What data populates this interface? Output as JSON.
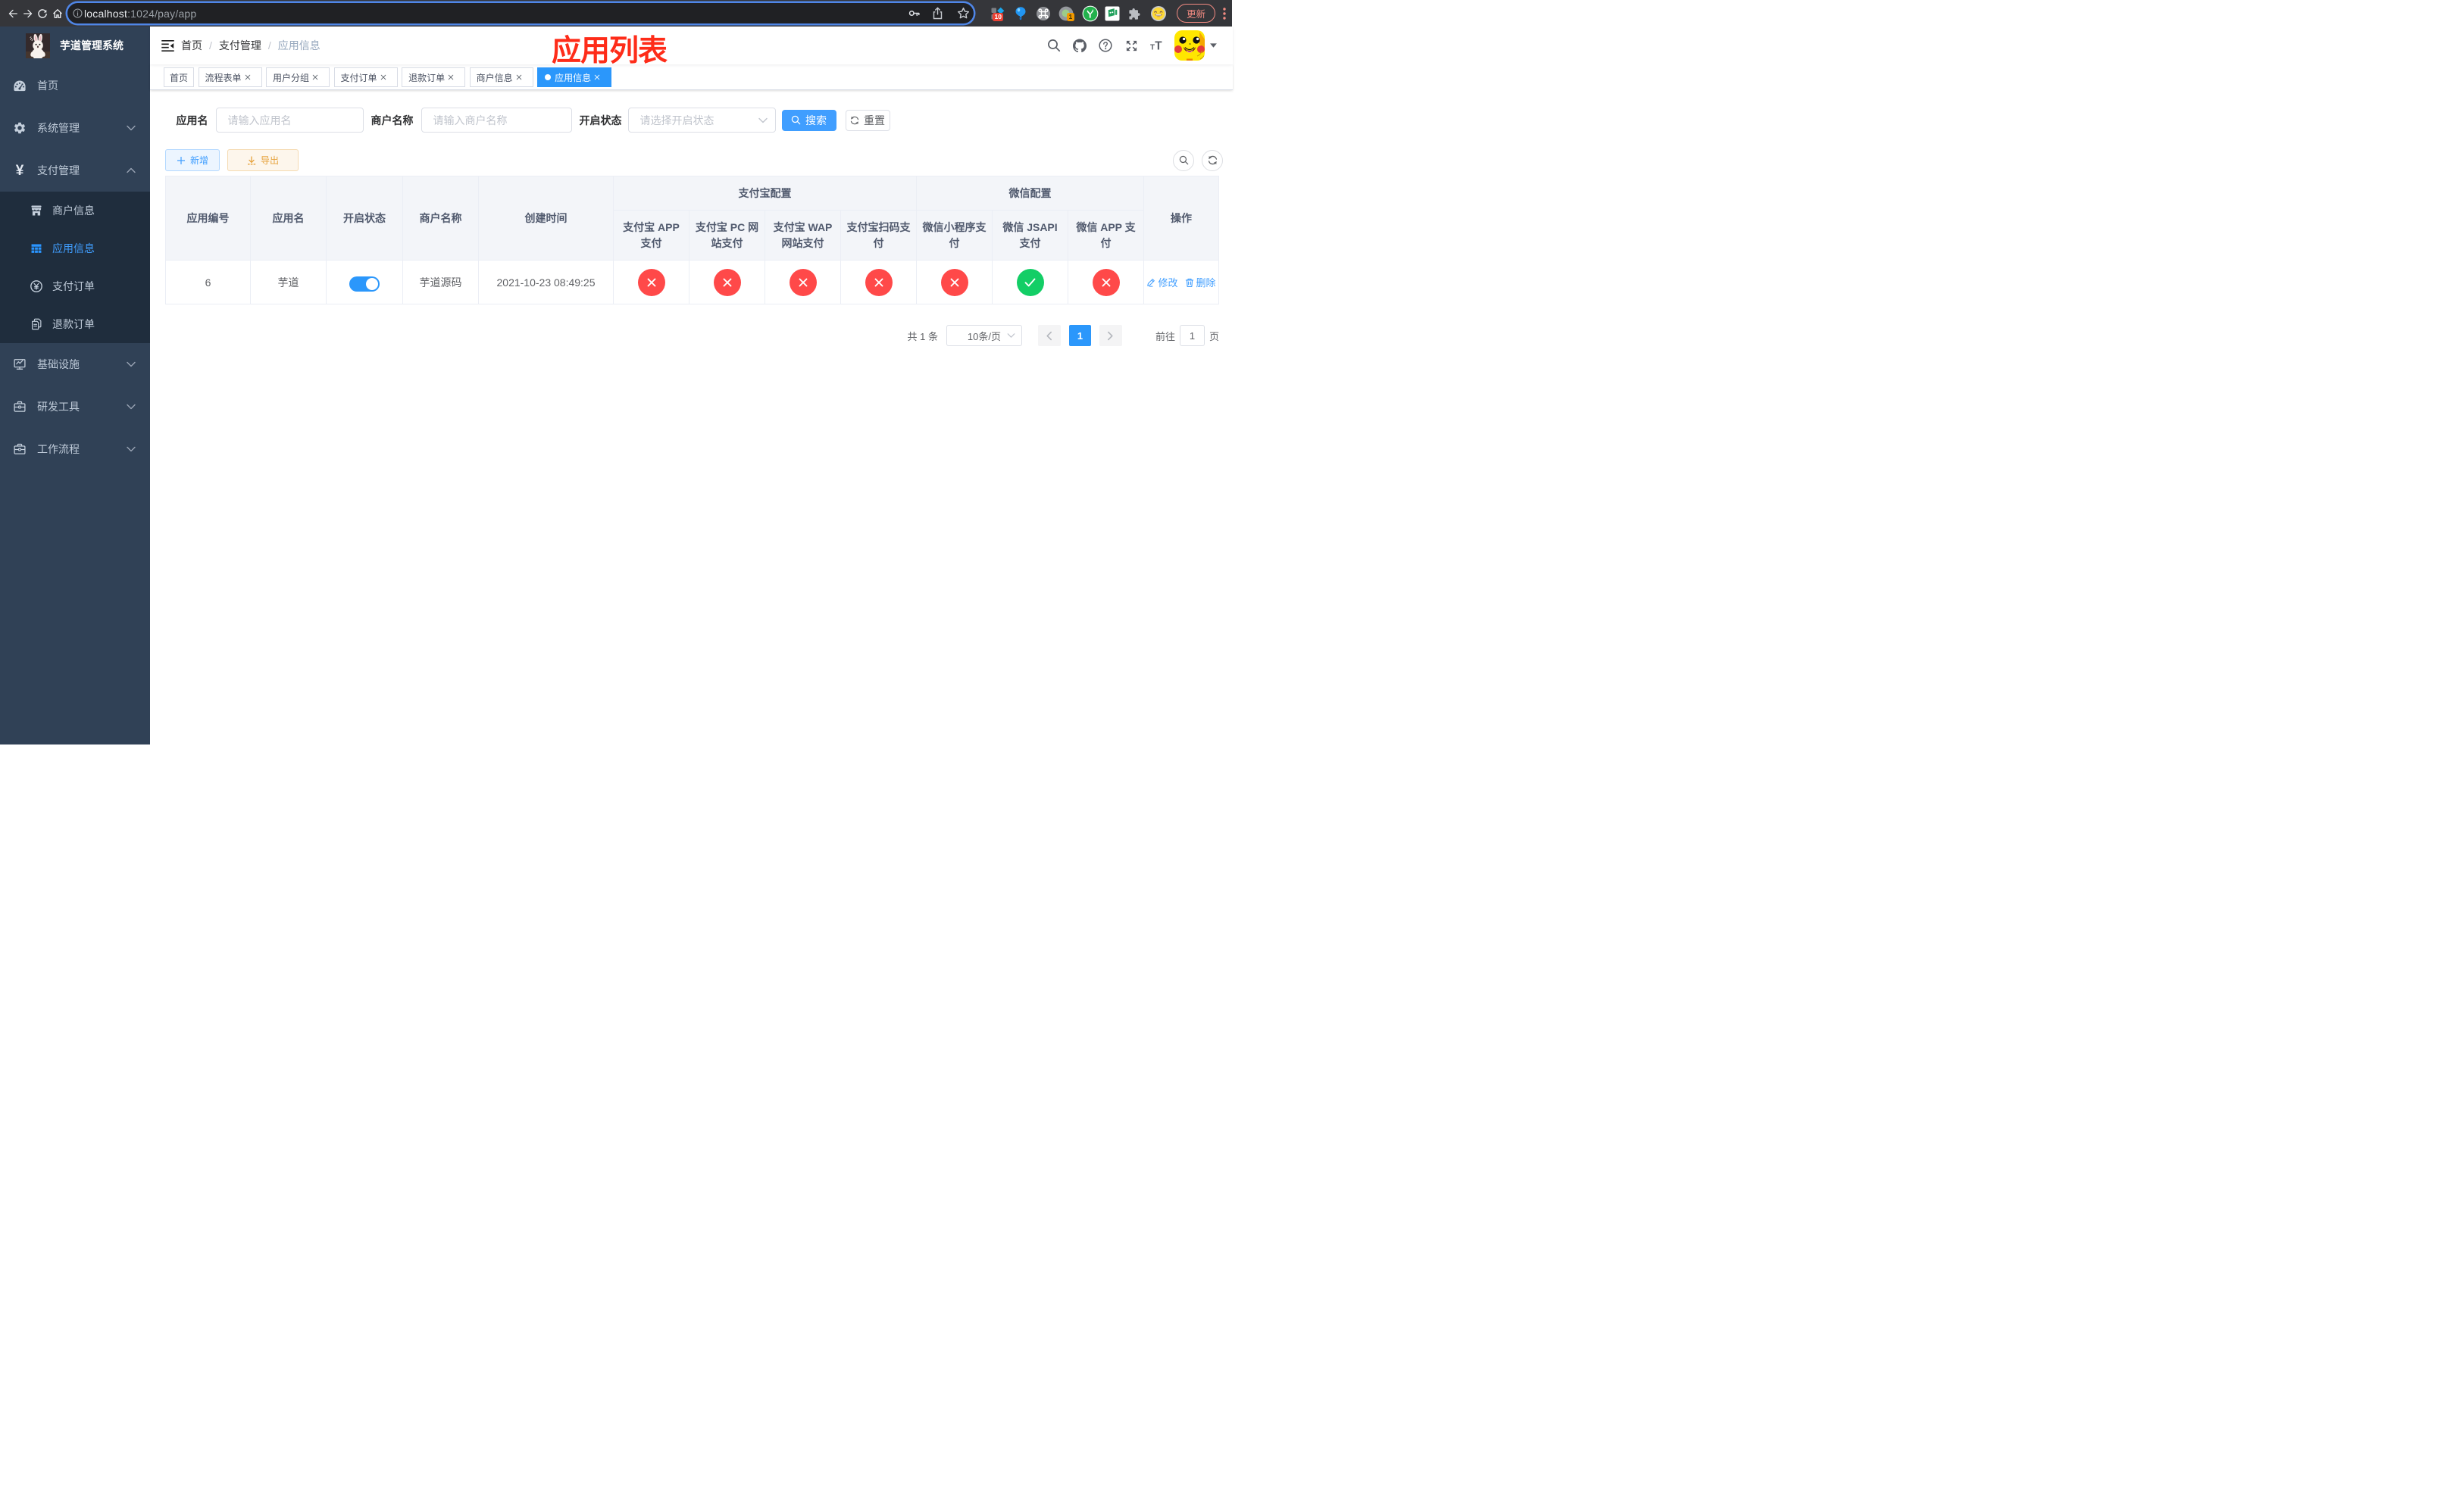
{
  "browser": {
    "url_host": "localhost",
    "url_rest": ":1024/pay/app",
    "update_label": "更新",
    "ext_badge_count_a": "10",
    "ext_badge_count_b": "1"
  },
  "annotation": {
    "text": "应用列表",
    "color": "#fe2c19"
  },
  "sidebar": {
    "logo_title": "芋道管理系统",
    "items": [
      {
        "label": "首页",
        "icon": "dashboard-icon"
      },
      {
        "label": "系统管理",
        "icon": "gear-icon",
        "chevron": "down"
      },
      {
        "label": "支付管理",
        "icon": "yen-icon",
        "chevron": "up"
      },
      {
        "label": "基础设施",
        "icon": "monitor-icon",
        "chevron": "down"
      },
      {
        "label": "研发工具",
        "icon": "toolbox-icon",
        "chevron": "down"
      },
      {
        "label": "工作流程",
        "icon": "briefcase-icon",
        "chevron": "down"
      }
    ],
    "pay_children": [
      {
        "label": "商户信息",
        "icon": "shop-icon",
        "active": false
      },
      {
        "label": "应用信息",
        "icon": "grid-icon",
        "active": true
      },
      {
        "label": "支付订单",
        "icon": "coin-icon",
        "active": false
      },
      {
        "label": "退款订单",
        "icon": "documents-icon",
        "active": false
      }
    ]
  },
  "navbar": {
    "breadcrumb": [
      "首页",
      "支付管理",
      "应用信息"
    ]
  },
  "tabs": [
    {
      "label": "首页",
      "closable": false,
      "active": false
    },
    {
      "label": "流程表单",
      "closable": true,
      "active": false
    },
    {
      "label": "用户分组",
      "closable": true,
      "active": false
    },
    {
      "label": "支付订单",
      "closable": true,
      "active": false
    },
    {
      "label": "退款订单",
      "closable": true,
      "active": false
    },
    {
      "label": "商户信息",
      "closable": true,
      "active": false
    },
    {
      "label": "应用信息",
      "closable": true,
      "active": true
    }
  ],
  "filters": {
    "app_name_label": "应用名",
    "app_name_placeholder": "请输入应用名",
    "merchant_label": "商户名称",
    "merchant_placeholder": "请输入商户名称",
    "status_label": "开启状态",
    "status_placeholder": "请选择开启状态",
    "search_label": "搜索",
    "reset_label": "重置"
  },
  "toolbar": {
    "add_label": "新增",
    "export_label": "导出"
  },
  "table": {
    "headers": {
      "id": "应用编号",
      "name": "应用名",
      "enabled": "开启状态",
      "merchant": "商户名称",
      "created": "创建时间",
      "alipay_group": "支付宝配置",
      "wechat_group": "微信配置",
      "alipay_app": [
        "支付宝 APP",
        "支付"
      ],
      "alipay_pc": [
        "支付宝 PC 网",
        "站支付"
      ],
      "alipay_wap": [
        "支付宝 WAP",
        "网站支付"
      ],
      "alipay_qr": [
        "支付宝扫码支",
        "付"
      ],
      "wx_lite": [
        "微信小程序支",
        "付"
      ],
      "wx_jsapi": [
        "微信 JSAPI",
        "支付"
      ],
      "wx_app": [
        "微信 APP 支",
        "付"
      ],
      "ops": "操作"
    },
    "row": {
      "id": "6",
      "name": "芋道",
      "enabled": true,
      "merchant": "芋道源码",
      "created": "2021-10-23 08:49:25",
      "configs": [
        false,
        false,
        false,
        false,
        false,
        true,
        false
      ],
      "edit_label": "修改",
      "delete_label": "删除"
    }
  },
  "pagination": {
    "total": "共 1 条",
    "page_size": "10条/页",
    "page": "1",
    "goto_label": "前往",
    "goto_value": "1",
    "unit_label": "页"
  },
  "colors": {
    "primary": "#409eff",
    "primary_fill": "#2b97fb",
    "danger": "#ff4949",
    "success": "#13ce66",
    "warning": "#e6a23c",
    "sidebar_bg": "#304156",
    "submenu_bg": "#1f2d3d",
    "sidebar_text": "#bfcbd9",
    "annotation_red": "#fe2c19"
  }
}
